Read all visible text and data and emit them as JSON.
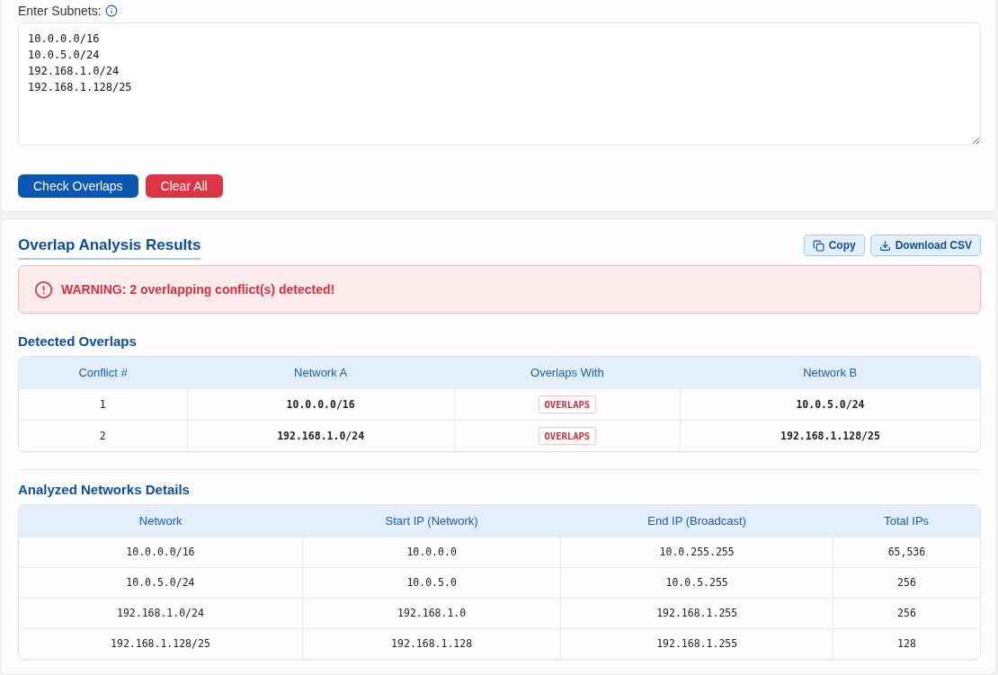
{
  "input_panel": {
    "label": "Enter Subnets:",
    "value": "10.0.0.0/16\n10.0.5.0/24\n192.168.1.0/24\n192.168.1.128/25",
    "buttons": [
      {
        "label": "Check Overlaps",
        "kind": "primary"
      },
      {
        "label": "Clear All",
        "kind": "danger"
      }
    ]
  },
  "results": {
    "title": "Overlap Analysis Results",
    "actions": [
      {
        "label": "Copy",
        "kind": "copy"
      },
      {
        "label": "Download CSV",
        "kind": "download"
      }
    ],
    "alert": {
      "kind": "danger",
      "text": "WARNING: 2 overlapping conflict(s) detected!"
    },
    "overlaps": {
      "title": "Detected Overlaps",
      "columns": [
        "Conflict #",
        "Network A",
        "Overlaps With",
        "Network B"
      ],
      "rows": [
        {
          "conflict": "1",
          "network_a": "10.0.0.0/16",
          "relation": "OVERLAPS",
          "network_b": "10.0.5.0/24"
        },
        {
          "conflict": "2",
          "network_a": "192.168.1.0/24",
          "relation": "OVERLAPS",
          "network_b": "192.168.1.128/25"
        }
      ]
    },
    "details": {
      "title": "Analyzed Networks Details",
      "columns": [
        "Network",
        "Start IP (Network)",
        "End IP (Broadcast)",
        "Total IPs"
      ],
      "rows": [
        [
          "10.0.0.0/16",
          "10.0.0.0",
          "10.0.255.255",
          "65,536"
        ],
        [
          "10.0.5.0/24",
          "10.0.5.0",
          "10.0.5.255",
          "256"
        ],
        [
          "192.168.1.0/24",
          "192.168.1.0",
          "192.168.1.255",
          "256"
        ],
        [
          "192.168.1.128/25",
          "192.168.1.128",
          "192.168.1.255",
          "128"
        ]
      ]
    }
  }
}
